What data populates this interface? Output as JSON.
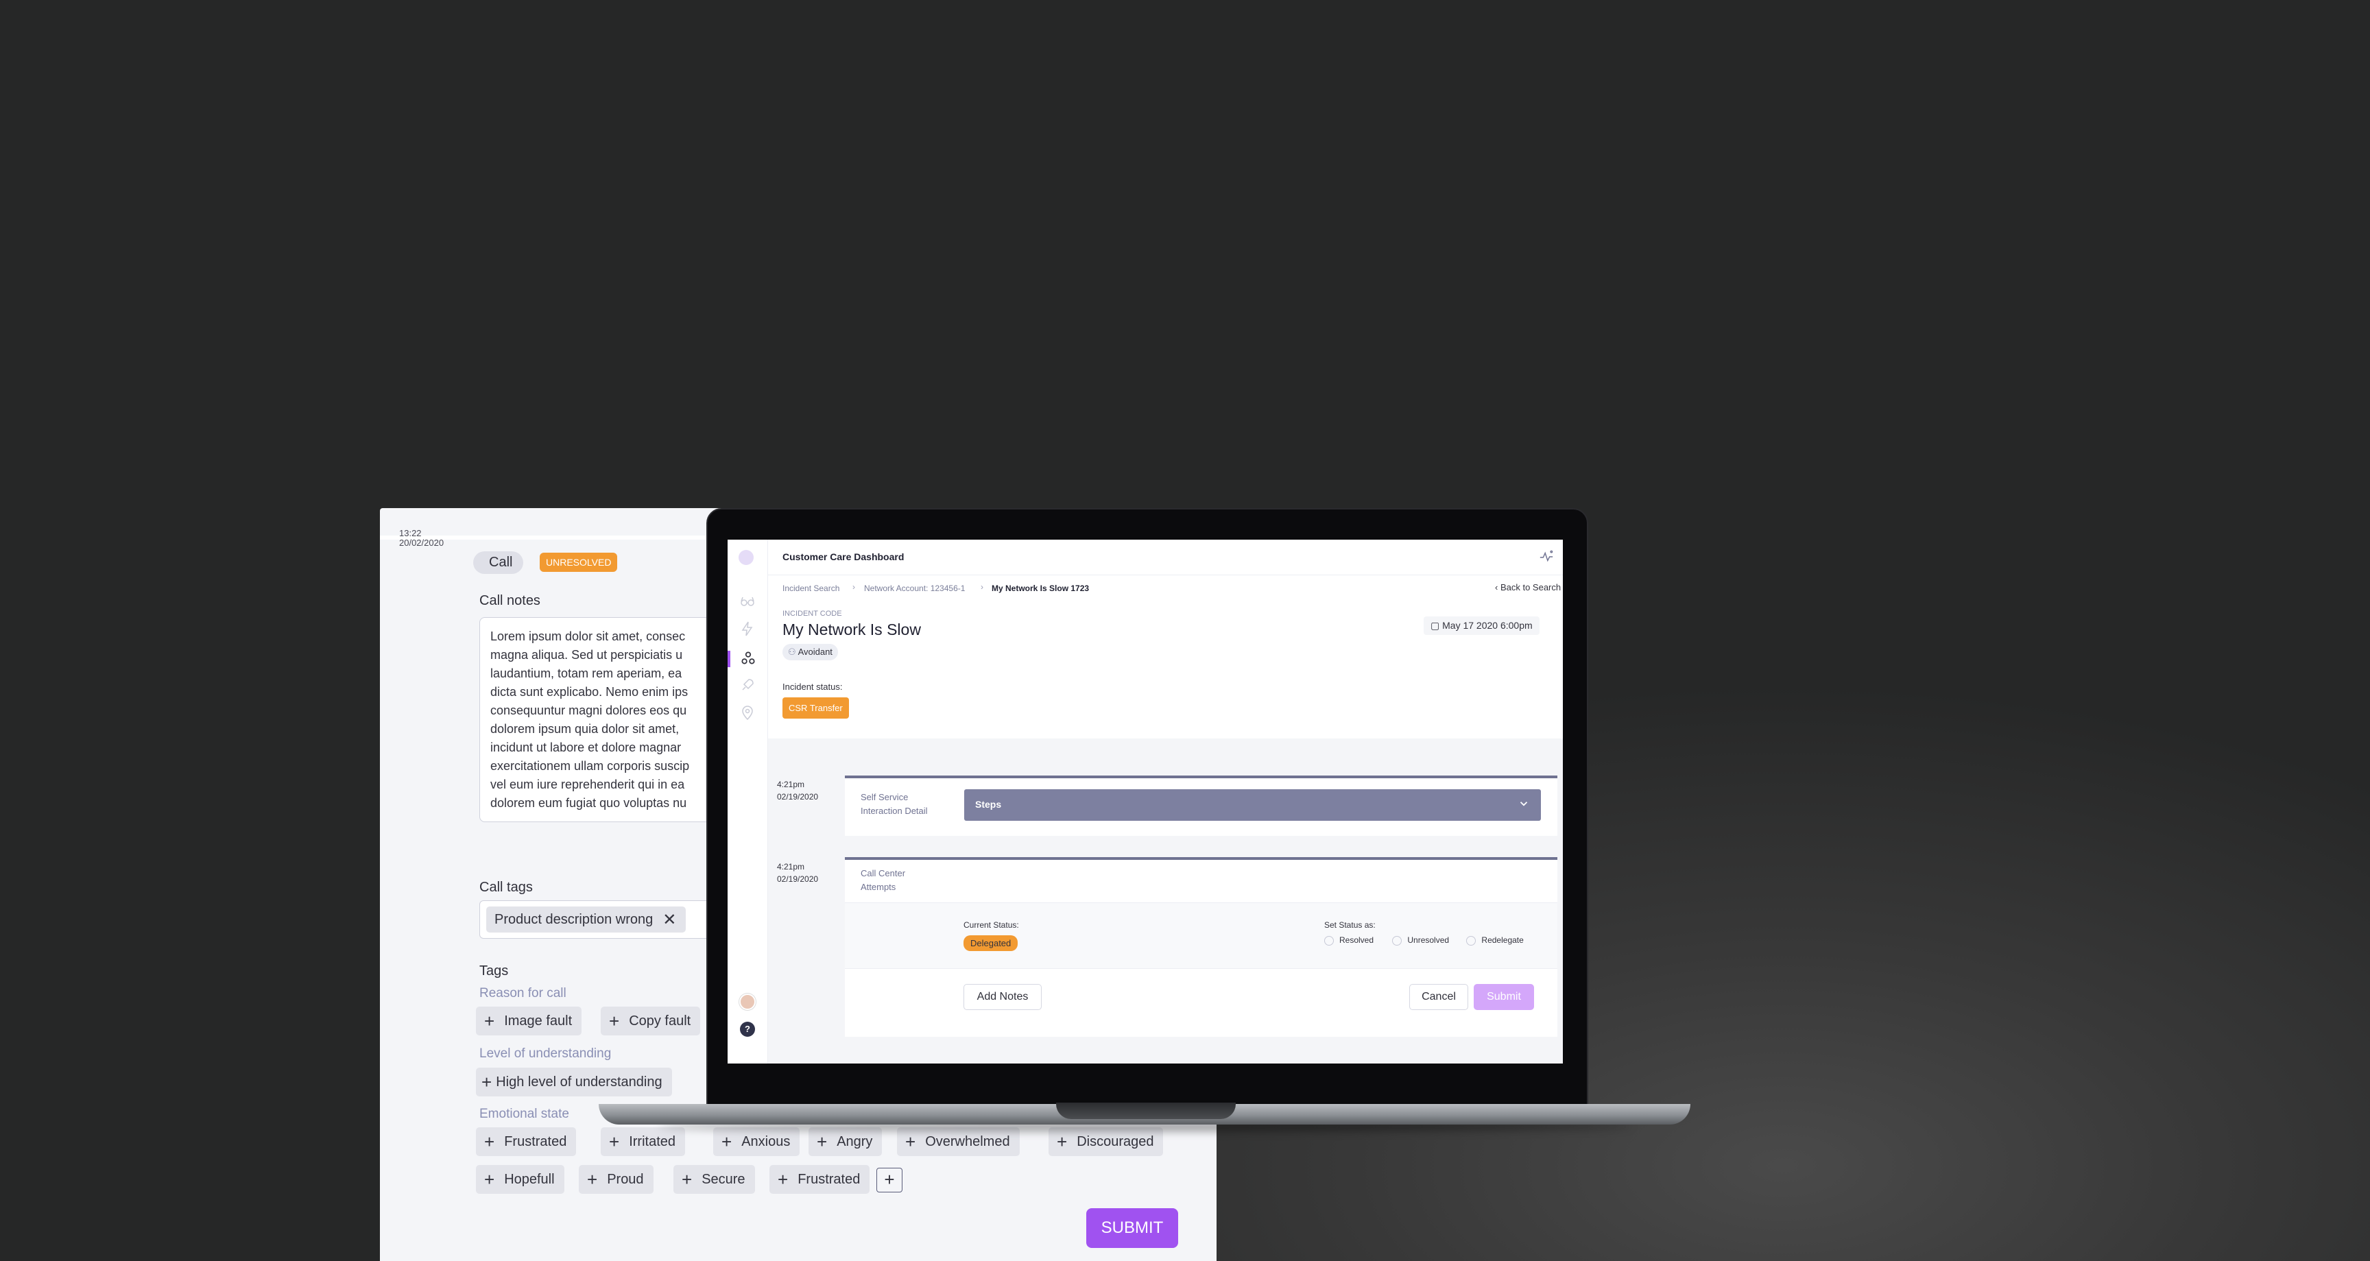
{
  "back_panel": {
    "time": "13:22",
    "date": "20/02/2020",
    "type_label": "Call",
    "status_badge": "UNRESOLVED",
    "call_notes_label": "Call notes",
    "call_notes_lines": [
      "Lorem ipsum dolor sit amet, consec",
      "magna aliqua. Sed ut perspiciatis u",
      "laudantium, totam rem aperiam, ea",
      "dicta sunt explicabo. Nemo enim ips",
      "consequuntur magni dolores eos qu",
      "dolorem ipsum quia dolor sit amet,",
      "incidunt ut labore et dolore magnar",
      "exercitationem ullam corporis suscip",
      "vel eum iure reprehenderit qui in ea",
      "dolorem eum fugiat quo voluptas nu"
    ],
    "call_tags_label": "Call tags",
    "call_tag_chip": "Product description wrong",
    "tags_label": "Tags",
    "reason_label": "Reason for call",
    "reason_chips": [
      "Image fault",
      "Copy fault"
    ],
    "understanding_label": "Level of understanding",
    "understanding_chips": [
      "High level of understanding"
    ],
    "emotional_label": "Emotional state",
    "emotional_row1": [
      "Frustrated",
      "Irritated",
      "Anxious",
      "Angry",
      "Overwhelmed",
      "Discouraged"
    ],
    "emotional_row2": [
      "Hopefull",
      "Proud",
      "Secure",
      "Frustrated"
    ],
    "submit_label": "SUBMIT"
  },
  "dashboard": {
    "title": "Customer Care Dashboard",
    "breadcrumbs": [
      "Incident Search",
      "Network Account: 123456-1",
      "My Network Is Slow 1723"
    ],
    "back_link": "Back to Search",
    "incident_code_label": "INCIDENT CODE",
    "incident_title": "My Network Is Slow",
    "persona_tag": "Avoidant",
    "date": "May 17 2020 6:00pm",
    "status_label": "Incident status:",
    "status_value": "CSR Transfer",
    "timeline": [
      {
        "time": "4:21pm",
        "date": "02/19/2020",
        "title": "Self Service Interaction Detail",
        "dropdown": "Steps"
      },
      {
        "time": "4:21pm",
        "date": "02/19/2020",
        "title": "Call Center Attempts"
      }
    ],
    "current_status_label": "Current Status:",
    "current_status_value": "Delegated",
    "set_status_label": "Set Status as:",
    "status_options": [
      "Resolved",
      "Unresolved",
      "Redelegate"
    ],
    "add_notes_label": "Add Notes",
    "cancel_label": "Cancel",
    "submit_label": "Submit"
  },
  "colors": {
    "accent_purple": "#a052f0",
    "orange": "#f29a31",
    "slate": "#6f7291"
  }
}
